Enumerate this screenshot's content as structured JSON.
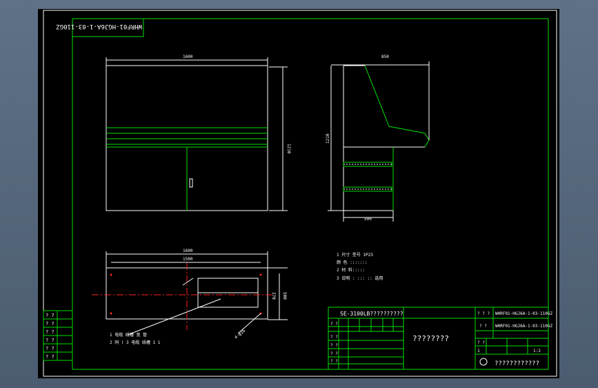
{
  "drawing": {
    "stamp_code": "WHRF01-HGJ6A-1-03-110GZ",
    "front_view": {
      "width_dim": "1600",
      "height_dim": "1210"
    },
    "side_view": {
      "depth_dim": "850",
      "height_dim": "1210",
      "base_dim": "500"
    },
    "plan_view": {
      "outer_dim": "1600",
      "inner_dim": "1500",
      "depth_dim": "500",
      "inner_depth_dim": "370",
      "hole_note": "4-φ16"
    },
    "notes": [
      "1 尺寸 型号 1P23",
      "颜 色 :::::::",
      "2  材 料:::::",
      "3 说明 : ::: :: 选用"
    ],
    "callouts": [
      "1 电缆 线槽 宽 管",
      "2 同 ( 3 电缆 线槽 1 1"
    ],
    "left_table": [
      "? ?",
      "? ?",
      "? ?",
      "? ?",
      "? ?",
      "? ?"
    ],
    "title_block": {
      "project": "SE-3100LB??????????",
      "drawing_no_1": "WHRF01-HGJ6A-1-03-110GZ",
      "drawing_no_2": "WHRF01-HGJ6A-1-03-110GZ",
      "drawing_name": "????????",
      "company": "????????????",
      "scale": "1:2",
      "sheet": "1",
      "q": "? ?",
      "qq": "? ? ?"
    }
  }
}
